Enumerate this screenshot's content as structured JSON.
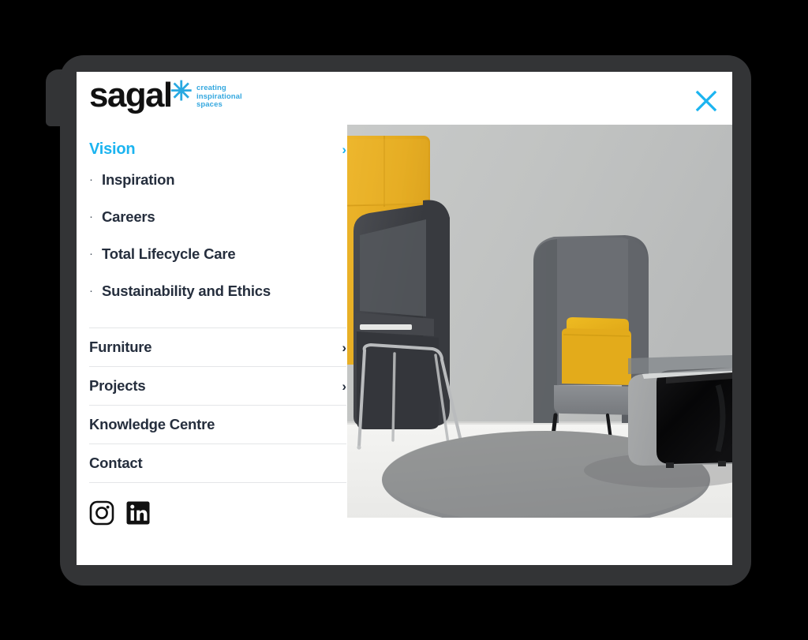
{
  "device": {
    "frame_color": "#333436",
    "screen_background": "#ffffff"
  },
  "header": {
    "logo_word": "sagal",
    "logo_star": "✳",
    "logo_star_color": "#29A9E1",
    "tagline": "creating\ninspirational\nspaces",
    "tagline_color": "#35A8DF",
    "close_icon": "close-icon",
    "close_color": "#1BB4F0"
  },
  "nav": {
    "active_item": {
      "label": "Vision",
      "color": "#1BB4F0",
      "chevron": "›"
    },
    "sub_items": [
      {
        "bullet": "·",
        "label": "Inspiration"
      },
      {
        "bullet": "·",
        "label": "Careers"
      },
      {
        "bullet": "·",
        "label": "Total Lifecycle Care"
      },
      {
        "bullet": "·",
        "label": "Sustainability and Ethics"
      }
    ],
    "items": [
      {
        "label": "Furniture",
        "chevron": "›",
        "has_chevron": true
      },
      {
        "label": "Projects",
        "chevron": "›",
        "has_chevron": true
      },
      {
        "label": "Knowledge Centre",
        "chevron": "",
        "has_chevron": false
      },
      {
        "label": "Contact",
        "chevron": "",
        "has_chevron": false
      }
    ],
    "socials": [
      {
        "name": "instagram-icon",
        "label": "Instagram"
      },
      {
        "name": "linkedin-icon",
        "label": "LinkedIn"
      }
    ]
  },
  "photo": {
    "alt": "Modern office lounge with two high-back wing armchairs, yellow acoustic wall panel, yellow cushion, round grey rug and a grey/black pod seat",
    "colors": {
      "wall": "#c2c4c3",
      "floor": "#f2f2f0",
      "panel_yellow": "#e8af2a",
      "chair_dark": "#3f4146",
      "chair_grey": "#6e7175",
      "cushion_yellow": "#e6b01f",
      "rug_grey": "#8e9091",
      "pod_black": "#0b0b0c"
    }
  }
}
